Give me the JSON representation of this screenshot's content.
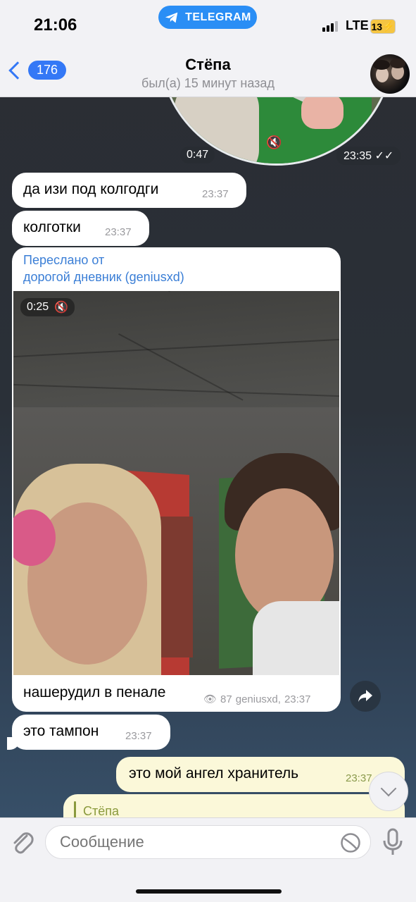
{
  "status_bar": {
    "time": "21:06",
    "banner": "TELEGRAM",
    "network": "LTE",
    "battery": "13"
  },
  "header": {
    "back_count": "176",
    "contact_name": "Стёпа",
    "contact_status": "был(а) 15 минут назад"
  },
  "messages": {
    "round_video": {
      "duration": "0:47",
      "time": "23:35"
    },
    "m1": {
      "text": "да изи под колгодги",
      "time": "23:37"
    },
    "m2": {
      "text": "колготки",
      "time": "23:37"
    },
    "forwarded": {
      "label": "Переслано от",
      "source": "дорогой дневник (geniusxd)",
      "video_duration": "0:25",
      "caption": "нашерудил в пенале",
      "views": "87",
      "author": "geniusxd,",
      "time": "23:37"
    },
    "m3": {
      "text": "это тампон",
      "time": "23:37"
    },
    "out1": {
      "text": "это мой ангел хранитель",
      "time": "23:37"
    },
    "reply_preview": {
      "name": "Стёпа"
    }
  },
  "input": {
    "placeholder": "Сообщение"
  },
  "colors": {
    "accent": "#3478f6",
    "telegram_banner": "#2a8ef5",
    "outgoing_bubble": "#fbf8d9",
    "incoming_bubble": "#ffffff"
  }
}
